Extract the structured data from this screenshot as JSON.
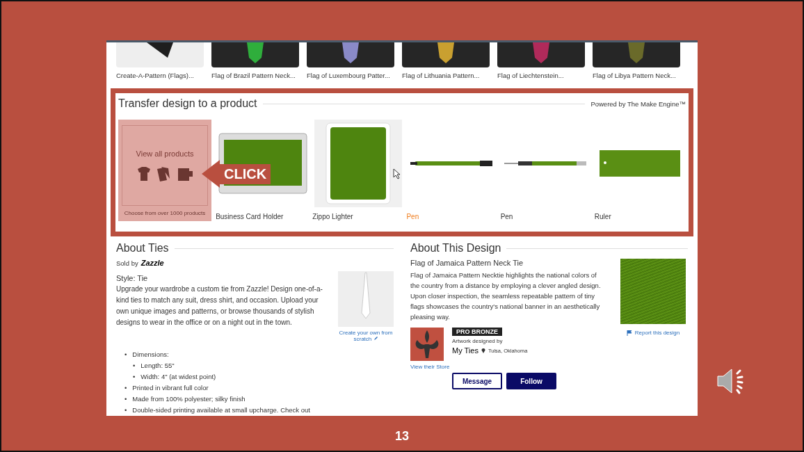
{
  "recent": [
    {
      "label": "Create-A-Pattern (Flags)...",
      "kind": "pattern",
      "color": "#1e1e1e"
    },
    {
      "label": "Flag of Brazil Pattern Neck...",
      "kind": "tie",
      "color": "#2fae3c"
    },
    {
      "label": "Flag of Luxembourg Patter...",
      "kind": "tie",
      "color": "#8a8ac8"
    },
    {
      "label": "Flag of Lithuania Pattern...",
      "kind": "tie",
      "color": "#c9a030"
    },
    {
      "label": "Flag of Liechtenstein...",
      "kind": "tie",
      "color": "#b02a5a"
    },
    {
      "label": "Flag of Libya Pattern Neck...",
      "kind": "tie",
      "color": "#6a6a2a"
    }
  ],
  "transfer": {
    "title": "Transfer design to a product",
    "powered": "Powered by The Make Engine™",
    "view_all": "View all products",
    "choose": "Choose from over 1000 products",
    "callout": "CLICK",
    "products": [
      {
        "label": "Business Card Holder",
        "kind": "card-holder",
        "highlighted": false
      },
      {
        "label": "Zippo Lighter",
        "kind": "lighter",
        "highlighted": false
      },
      {
        "label": "Pen",
        "kind": "pen",
        "highlighted": true
      },
      {
        "label": "Pen",
        "kind": "pen2",
        "highlighted": false
      },
      {
        "label": "Ruler",
        "kind": "ruler",
        "highlighted": false
      }
    ]
  },
  "about_ties": {
    "title": "About Ties",
    "sold_by": "Sold by",
    "brand": "Zazzle",
    "style": "Style: Tie",
    "description": "Upgrade your wardrobe a custom tie from Zazzle! Design one-of-a-kind ties to match any suit, dress shirt, and occasion. Upload your own unique images and patterns, or browse thousands of stylish designs to wear in the office or on a night out in the town.",
    "create_link": "Create your own from scratch",
    "bullets": [
      {
        "marker": "•",
        "text": "Dimensions:",
        "children": [
          {
            "marker": "•",
            "text": "Length: 55\""
          },
          {
            "marker": "•",
            "text": "Width: 4\" (at widest point)"
          }
        ]
      },
      {
        "marker": "•",
        "text": "Printed in vibrant full color"
      },
      {
        "marker": "•",
        "text": "Made from 100% polyester; silky finish"
      },
      {
        "marker": "•",
        "text": "Double-sided printing available at small upcharge. Check out"
      }
    ]
  },
  "about_design": {
    "title": "About This Design",
    "name": "Flag of Jamaica Pattern Neck Tie",
    "description": "Flag of Jamaica Pattern Necktie highlights the national colors of the country from a distance by employing a clever angled design. Upon closer inspection, the seamless repeatable pattern of tiny flags showcases the country's national banner in an aesthetically pleasing way.",
    "report": "Report this design",
    "badge": "PRO BRONZE",
    "designed_by": "Artwork designed by",
    "designer": "My Ties",
    "location": "Tulsa, Oklahoma",
    "store_link": "View their Store",
    "buttons": [
      "Message",
      "Follow"
    ]
  },
  "slide_number": "13"
}
